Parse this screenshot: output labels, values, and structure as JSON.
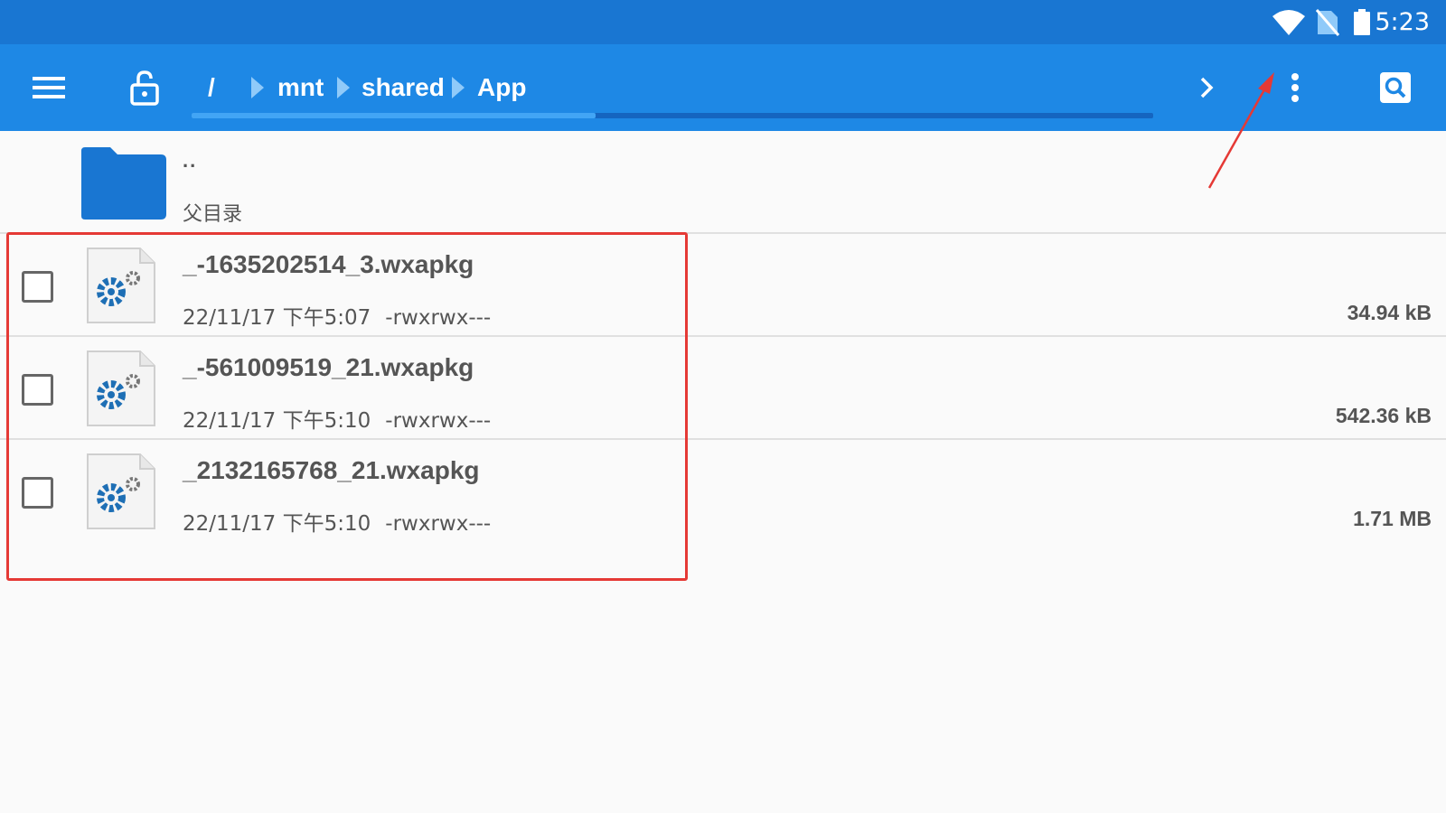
{
  "status_bar": {
    "time": "5:23",
    "icons": [
      "wifi-icon",
      "no-sim-icon",
      "battery-icon"
    ]
  },
  "toolbar": {
    "menu_icon": "hamburger-menu-icon",
    "lock_icon": "unlock-icon",
    "breadcrumb": [
      "/",
      "mnt",
      "shared",
      "App"
    ],
    "path_scroll_progress": 0.42,
    "forward_icon": "chevron-right-icon",
    "overflow_icon": "more-vert-icon",
    "search_icon": "search-icon"
  },
  "parent_entry": {
    "name": "..",
    "subtitle": "父目录"
  },
  "files": [
    {
      "name": "_-1635202514_3.wxapkg",
      "date": "22/11/17 下午5:07",
      "permissions": "-rwxrwx---",
      "size": "34.94 kB",
      "checked": false
    },
    {
      "name": "_-561009519_21.wxapkg",
      "date": "22/11/17 下午5:10",
      "permissions": "-rwxrwx---",
      "size": "542.36 kB",
      "checked": false
    },
    {
      "name": "_2132165768_21.wxapkg",
      "date": "22/11/17 下午5:10",
      "permissions": "-rwxrwx---",
      "size": "1.71 MB",
      "checked": false
    }
  ],
  "colors": {
    "status_bar": "#1976d2",
    "toolbar": "#1e88e5",
    "folder": "#1976d2",
    "annotation": "#e53935"
  }
}
